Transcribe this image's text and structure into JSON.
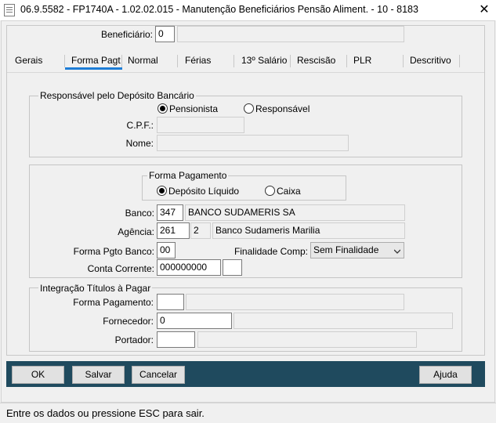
{
  "window": {
    "title": "06.9.5582 - FP1740A - 1.02.02.015 - Manutenção Beneficiários Pensão Aliment. - 10 - 8183",
    "close_glyph": "✕"
  },
  "header": {
    "beneficiario_label": "Beneficiário:",
    "beneficiario_value": "0",
    "beneficiario_name": ""
  },
  "tabs": [
    {
      "label": "Gerais"
    },
    {
      "label": "Forma Pagt",
      "active": true
    },
    {
      "label": "Normal"
    },
    {
      "label": "Férias"
    },
    {
      "label": "13º Salário"
    },
    {
      "label": "Rescisão"
    },
    {
      "label": "PLR"
    },
    {
      "label": "Descritivo"
    }
  ],
  "responsavel_group": {
    "title": "Responsável pelo Depósito Bancário",
    "radio_pensionista": "Pensionista",
    "radio_responsavel": "Responsável",
    "selected": "Pensionista",
    "cpf_label": "C.P.F.:",
    "cpf_value": "",
    "nome_label": "Nome:",
    "nome_value": ""
  },
  "pagamento": {
    "forma_title": "Forma Pagamento",
    "radio_deposito": "Depósito Líquido",
    "radio_caixa": "Caixa",
    "selected": "Depósito Líquido",
    "banco_label": "Banco:",
    "banco_code": "347",
    "banco_name": "BANCO SUDAMERIS SA",
    "agencia_label": "Agência:",
    "agencia_code": "261",
    "agencia_digit": "2",
    "agencia_name": "Banco Sudameris Marilia",
    "forma_pgto_banco_label": "Forma Pgto Banco:",
    "forma_pgto_banco_value": "00",
    "finalidade_label": "Finalidade Comp:",
    "finalidade_value": "Sem Finalidade",
    "conta_label": "Conta Corrente:",
    "conta_value": "000000000",
    "conta_digit": ""
  },
  "integracao": {
    "title": "Integração Títulos à Pagar",
    "forma_pagamento_label": "Forma Pagamento:",
    "forma_pagamento_code": "",
    "forma_pagamento_desc": "",
    "fornecedor_label": "Fornecedor:",
    "fornecedor_code": "0",
    "fornecedor_desc": "",
    "portador_label": "Portador:",
    "portador_code": "",
    "portador_desc": ""
  },
  "buttons": {
    "ok": "OK",
    "salvar": "Salvar",
    "cancelar": "Cancelar",
    "ajuda": "Ajuda"
  },
  "status": {
    "text": "Entre os dados ou pressione ESC para sair."
  }
}
